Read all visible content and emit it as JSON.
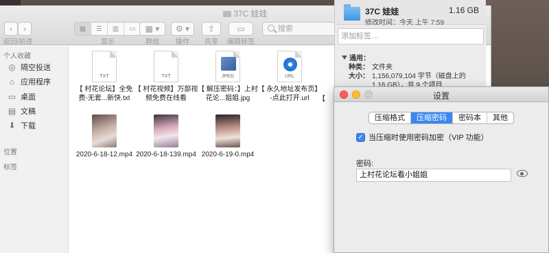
{
  "window": {
    "title": "37C 娃娃"
  },
  "toolbar": {
    "nav_label": "返回/前进",
    "view_label": "显示",
    "group_label": "群组",
    "action_label": "操作",
    "share_label": "共享",
    "edit_tags_label": "编辑标签",
    "search_placeholder": "搜索"
  },
  "sidebar": {
    "favorites_header": "个人收藏",
    "items": [
      {
        "label": "隔空投送",
        "icon": "airdrop-icon"
      },
      {
        "label": "应用程序",
        "icon": "applications-icon"
      },
      {
        "label": "桌面",
        "icon": "desktop-icon"
      },
      {
        "label": "文稿",
        "icon": "documents-icon"
      },
      {
        "label": "下载",
        "icon": "downloads-icon"
      }
    ],
    "locations_header": "位置",
    "tags_header": "标签"
  },
  "files": [
    {
      "name": "【 村花论坛】全免费-无套...新快.txt",
      "type": "TXT"
    },
    {
      "name": "【 村花视频】万部视频免费在线看",
      "type": "TXT"
    },
    {
      "name": "【 解压密码：】上村花论...姐姐.jpg",
      "type": "JPEG"
    },
    {
      "name": "【 永久地址发布页】-点此打开.url",
      "type": "URL"
    },
    {
      "name": "【",
      "type": "TXT"
    },
    {
      "name": "2020-6-18-12.mp4",
      "type": "video"
    },
    {
      "name": "2020-6-18-139.mp4",
      "type": "video"
    },
    {
      "name": "2020-6-19-0.mp4",
      "type": "video"
    }
  ],
  "info": {
    "name": "37C 娃娃",
    "size": "1.16 GB",
    "modified": "修改时间：今天 上午 7:59",
    "tags_placeholder": "添加标签…",
    "general_header": "通用：",
    "kind_key": "种类：",
    "kind_value": "文件夹",
    "size_key": "大小：",
    "size_value": "1,156,079,104 字节（磁盘上的 1.16 GB），共 9 个项目"
  },
  "dialog": {
    "title": "设置",
    "tabs": [
      "压缩格式",
      "压缩密码",
      "密码本",
      "其他"
    ],
    "active_tab": "压缩密码",
    "checkbox_label": "当压缩时使用密码加密（VIP 功能）",
    "checkbox_checked": true,
    "password_label": "密码:",
    "password_value": "上村花论坛看小姐姐"
  }
}
